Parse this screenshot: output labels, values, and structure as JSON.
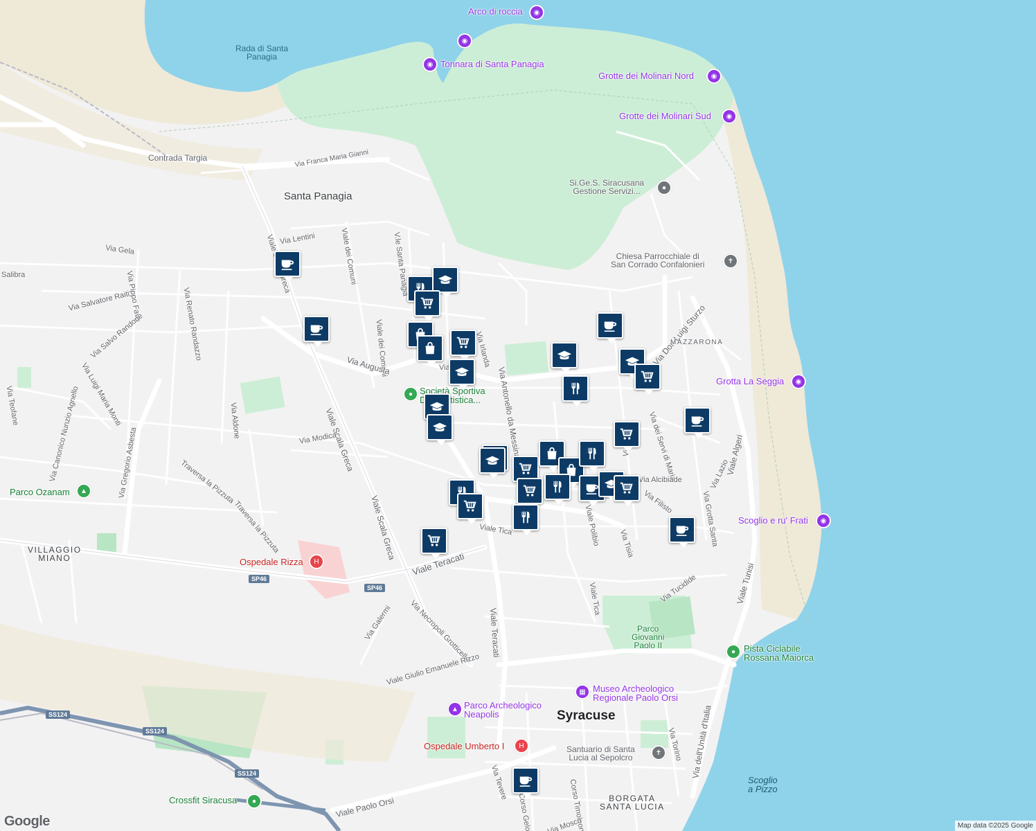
{
  "map": {
    "attribution": "Map data ©2025 Google",
    "logo": "Google",
    "colors": {
      "sea": "#8fd3ea",
      "land": "#f3f2f2",
      "park": "#cdeed6",
      "sand": "#efe9d8",
      "road": "#ffffff",
      "pin": "#0d3b66",
      "poi": "#9334e6",
      "hospital": "#e8444c",
      "park_dot": "#34a853"
    }
  },
  "labels": {
    "arco": "Arco di roccia",
    "rada": "Rada di Santa\nPanagia",
    "tonnara": "Tonnara di Santa Panagia",
    "grotte_nord": "Grotte dei Molinari Nord",
    "grotte_sud": "Grotte dei Molinari Sud",
    "contrada_targia": "Contrada Targia",
    "franca_maria": "Via Franca Maria Gianni",
    "santa_panagia": "Santa Panagia",
    "sigess": "Si.Ge.S. Siracusana\nGestione Servizi...",
    "chiesa": "Chiesa Parrocchiale di\nSan Corrado Confalonieri",
    "via_lentini": "Via Lentini",
    "via_gela": "Via Gela",
    "salibra": "Salibra",
    "via_pippo_fava": "Via Pippo Fava",
    "via_salvatore_raiti": "Via Salvatore Raiti",
    "via_salvo_randone": "Via Salvo Randone",
    "via_renato_randazzo": "Via Renato Randazzo",
    "viale_scala_greca_top": "Viale Scala Greca",
    "viale_dei_comuni_1": "Viale dei Comuni",
    "viale_dei_comuni_2": "Viale dei Comuni",
    "vle_santa_panagia": "V.le Santa Panagia",
    "via_irlanda": "Via Irlanda",
    "via_augusta": "Via Augusta",
    "via_antonello": "Via Antonello da Messina",
    "don_luigi_sturzo": "Via Don Luigi Sturzo",
    "mazzarona": "MAZZARONA",
    "grotta_seggia": "Grotta La Seggia",
    "societa": "Società Sportiva\nDilettantistica...",
    "via_teofane": "Via Teofane",
    "via_luigi_maria_monti": "Via Luigi Maria Monti",
    "via_canonico": "Via Canonico Nunzio Agnello",
    "via_gregorio": "Via Gregorio Asbesta",
    "via_aldone": "Via Aldone",
    "viale_scala_greca_mid": "Viale Scala Greca",
    "via_modica": "Via Modica",
    "via_servi_maria": "Via dei Servi di Maria",
    "viale_algeri": "Viale Algeri",
    "via_lazio": "Via Lazio",
    "via_grotta_santa": "Via Grotta Santa",
    "via_alcibiade": "Via Alcibiade",
    "via_filisto": "Via Filisto",
    "viale_polibio": "Viale Polibio",
    "via_tisia": "Via Tisia",
    "scoglio_frati": "Scoglio e ru' Frati",
    "parco_ozanam": "Parco Ozanam",
    "traversa_1": "Traversa la Pizzuta",
    "traversa_2": "Traversa la Pizzuta",
    "viale_tica_1": "Viale Tica",
    "viale_tica_2": "Viale Tica",
    "villaggio_miano": "VILLAGGIO\nMIANO",
    "ospedale_rizza": "Ospedale Rizza",
    "viale_teracati_1": "Viale Teracati",
    "viale_teracati_2": "Viale Teracati",
    "viale_scala_greca_low": "Viale Scala Greca",
    "via_tucidide": "Via Tucidide",
    "viale_tunisi": "Viale Tunisi",
    "via_necropoli": "Via Necropoli Grotticelle",
    "via_galermi": "Via Galermi",
    "viale_giulio": "Viale Giulio Emanuele Rizzo",
    "parco_giovanni": "Parco\nGiovanni\nPaolo II",
    "pista_ciclabile": "Pista Ciclabile\nRossana Maiorca",
    "museo": "Museo Archeologico\nRegionale Paolo Orsi",
    "parco_archeologico": "Parco Archeologico\nNeapolis",
    "syracuse": "Syracuse",
    "via_unita": "Via dell'Unità d'Italia",
    "via_torino": "Via Torino",
    "ospedale_umberto": "Ospedale Umberto I",
    "santuario": "Santuario di Santa\nLucia al Sepolcro",
    "scoglio_pizzo": "Scoglio\na Pizzo",
    "via_tevere": "Via Tevere",
    "corso_gelone": "Corso Gelone",
    "corso_timoleonte": "Corso Timoleonte",
    "borgata": "BORGATA\nSANTA LUCIA",
    "viale_paolo_orsi": "Viale Paolo Orsi",
    "crossfit": "Crossfit Siracusa",
    "via_mosco": "Via Mosco",
    "via_fili": "Via Fili",
    "via_tiny": "Via"
  },
  "shields": [
    "SP46",
    "SS124",
    "SS124",
    "SS124"
  ],
  "pins": [
    {
      "type": "cafe-icon"
    },
    {
      "type": "cafe-icon"
    },
    {
      "type": "restaurant-icon"
    },
    {
      "type": "school-icon"
    },
    {
      "type": "grocery-icon"
    },
    {
      "type": "grocery-icon"
    },
    {
      "type": "shopping-icon"
    },
    {
      "type": "shopping-icon"
    },
    {
      "type": "school-icon"
    },
    {
      "type": "school-icon"
    },
    {
      "type": "school-icon"
    },
    {
      "type": "school-icon"
    },
    {
      "type": "school-icon"
    },
    {
      "type": "restaurant-icon"
    },
    {
      "type": "cafe-icon"
    },
    {
      "type": "school-icon"
    },
    {
      "type": "grocery-icon"
    },
    {
      "type": "cafe-icon"
    },
    {
      "type": "grocery-icon"
    },
    {
      "type": "school-icon"
    },
    {
      "type": "grocery-icon"
    },
    {
      "type": "shopping-icon"
    },
    {
      "type": "restaurant-icon"
    },
    {
      "type": "shopping-icon"
    },
    {
      "type": "grocery-icon"
    },
    {
      "type": "restaurant-icon"
    },
    {
      "type": "cafe-icon"
    },
    {
      "type": "school-icon"
    },
    {
      "type": "grocery-icon"
    },
    {
      "type": "restaurant-icon"
    },
    {
      "type": "grocery-icon"
    },
    {
      "type": "grocery-icon"
    },
    {
      "type": "restaurant-icon"
    },
    {
      "type": "cafe-icon"
    },
    {
      "type": "cafe-icon"
    }
  ]
}
